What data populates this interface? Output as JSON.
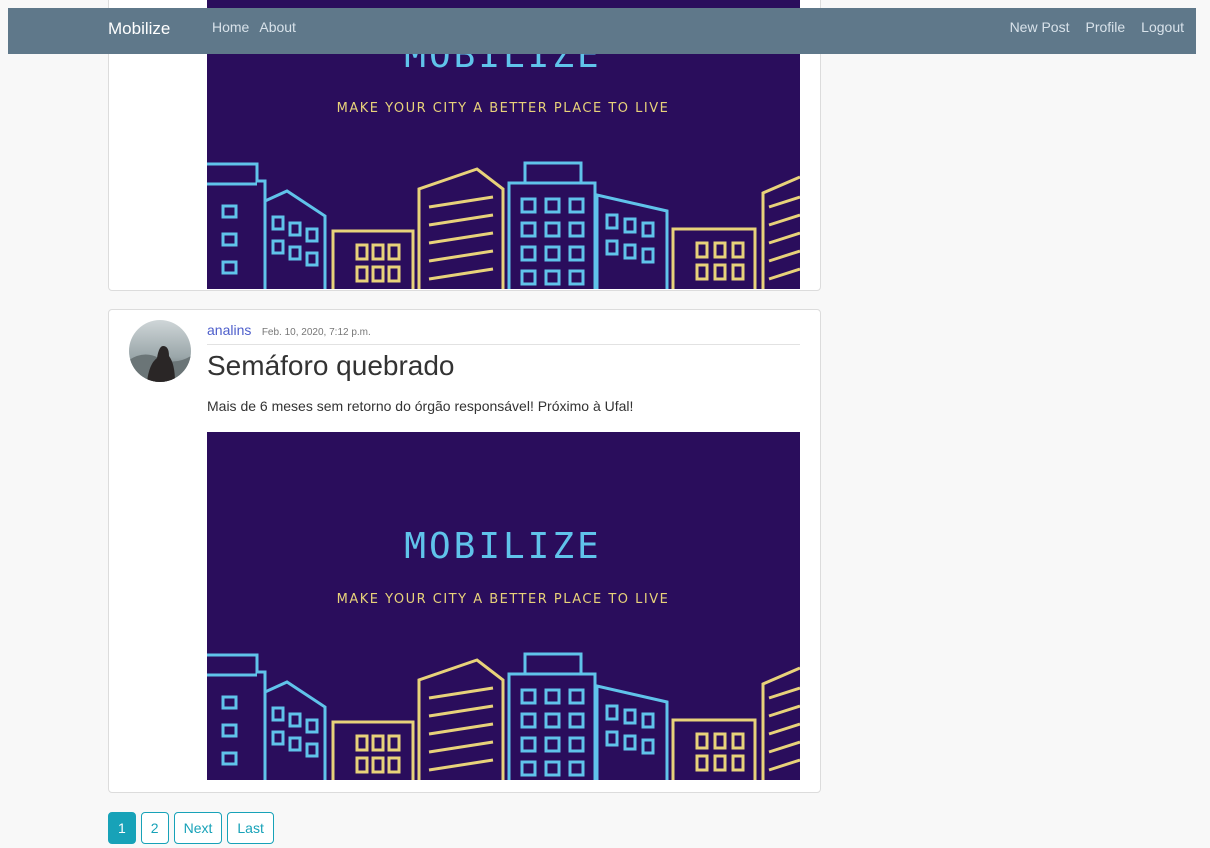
{
  "navbar": {
    "brand": "Mobilize",
    "left_links": [
      "Home",
      "About"
    ],
    "right_links": [
      "New Post",
      "Profile",
      "Logout"
    ]
  },
  "banner": {
    "title": "MOBILIZE",
    "tagline": "MAKE YOUR CITY A BETTER PLACE TO LIVE"
  },
  "posts": [
    {
      "author": "",
      "date": "",
      "title": "",
      "content": ""
    },
    {
      "author": "analins",
      "date": "Feb. 10, 2020, 7:12 p.m.",
      "title": "Semáforo quebrado",
      "content": "Mais de 6 meses sem retorno do órgão responsável! Próximo à Ufal!"
    }
  ],
  "pagination": {
    "pages": [
      "1",
      "2"
    ],
    "current": "1",
    "next_label": "Next",
    "last_label": "Last"
  },
  "colors": {
    "navbar": "#5f788a",
    "banner_bg": "#2a0d5c",
    "banner_cyan": "#60c3ea",
    "banner_yellow": "#e8d27a",
    "pagination_accent": "#17a2b8",
    "author_link": "#4d5ecb"
  }
}
